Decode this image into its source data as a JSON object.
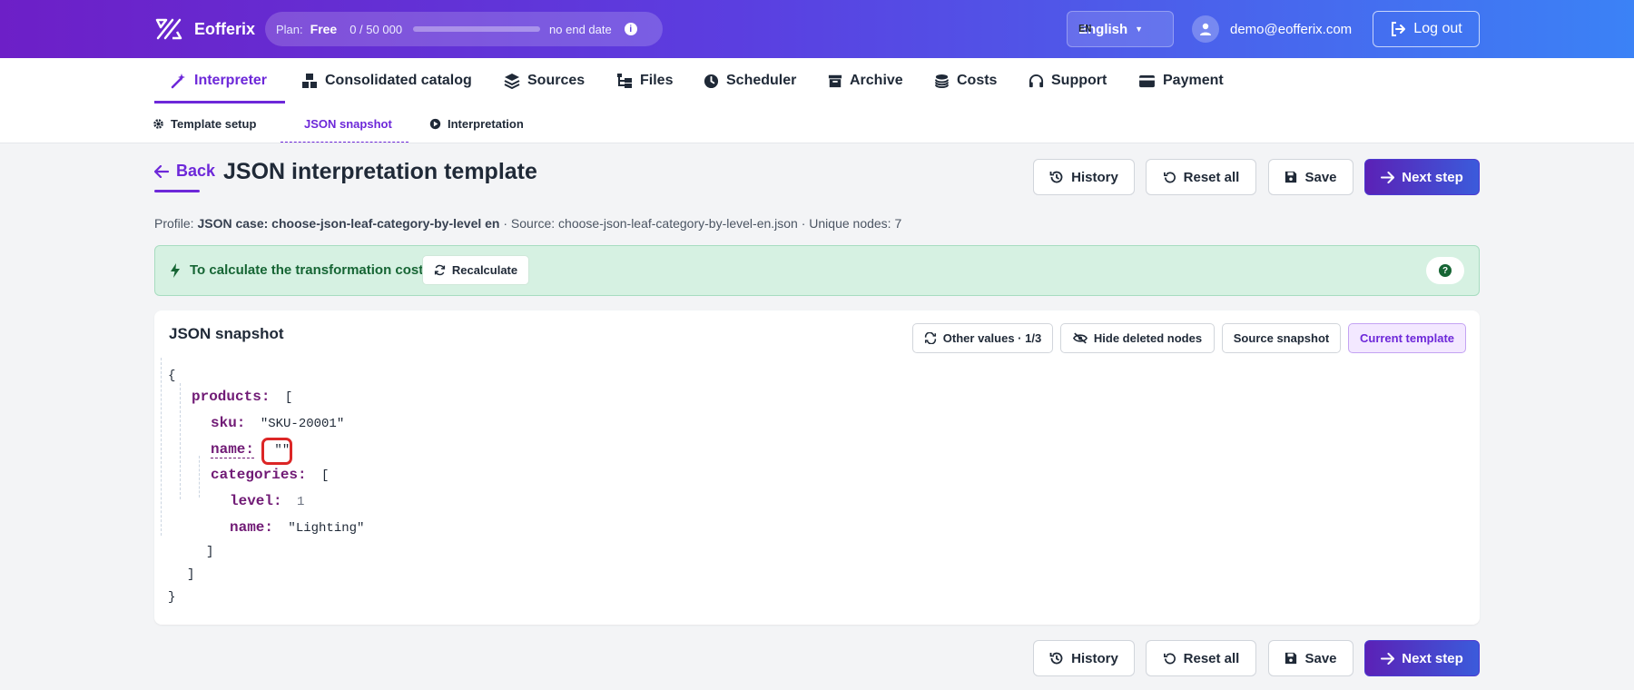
{
  "app": {
    "name": "Eofferix"
  },
  "plan": {
    "label": "Plan:",
    "name": "Free",
    "usage": "0 / 50 000",
    "usage_fraction": 0,
    "end_date": "no end date"
  },
  "language": {
    "code": "EN",
    "name": "English"
  },
  "user": {
    "email": "demo@eofferix.com"
  },
  "logout_label": "Log out",
  "nav": {
    "items": [
      {
        "label": "Interpreter",
        "icon": "wand-icon",
        "active": true
      },
      {
        "label": "Consolidated catalog",
        "icon": "boxes-icon"
      },
      {
        "label": "Sources",
        "icon": "layers-icon"
      },
      {
        "label": "Files",
        "icon": "folder-tree-icon"
      },
      {
        "label": "Scheduler",
        "icon": "clock-icon"
      },
      {
        "label": "Archive",
        "icon": "archive-icon"
      },
      {
        "label": "Costs",
        "icon": "coins-icon"
      },
      {
        "label": "Support",
        "icon": "headset-icon"
      },
      {
        "label": "Payment",
        "icon": "credit-card-icon"
      }
    ]
  },
  "subnav": {
    "items": [
      {
        "label": "Template setup",
        "icon": "gear-icon"
      },
      {
        "label": "JSON snapshot",
        "active": true
      },
      {
        "label": "Interpretation",
        "icon": "play-circle-icon"
      }
    ]
  },
  "header": {
    "back_label": "Back",
    "title": "JSON interpretation template"
  },
  "actions": {
    "history": "History",
    "reset": "Reset all",
    "save": "Save",
    "next": "Next step"
  },
  "profile": {
    "label": "Profile:",
    "name": "JSON case: choose-json-leaf-category-by-level en",
    "source": "· Source: choose-json-leaf-category-by-level-en.json · Unique nodes: 7"
  },
  "banner": {
    "text": "To calculate the transformation cost",
    "recalculate": "Recalculate",
    "help": "?"
  },
  "snapshot": {
    "title": "JSON snapshot",
    "toolbar": {
      "other_values": "Other values · 1/3",
      "hide_deleted": "Hide deleted nodes",
      "source_snapshot": "Source snapshot",
      "current_template": "Current template"
    },
    "json": {
      "open_brace": "{",
      "close_brace": "}",
      "products_key": "products:",
      "open_bracket": "[",
      "close_bracket": "]",
      "sku_key": "sku:",
      "sku_value": "\"SKU-20001\"",
      "name_key": "name:",
      "name_value": "\"\"",
      "categories_key": "categories:",
      "level_key": "level:",
      "level_value": "1",
      "cat_name_key": "name:",
      "cat_name_value": "\"Lighting\""
    }
  }
}
